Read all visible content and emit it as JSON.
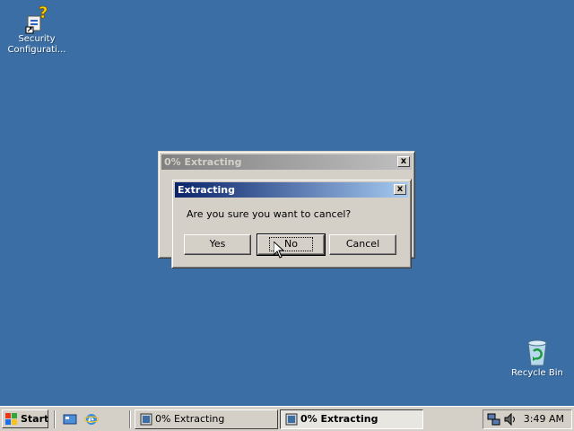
{
  "desktop": {
    "icons": [
      {
        "label": "Security Configurati...",
        "icon": "security-config-icon"
      },
      {
        "label": "Recycle Bin",
        "icon": "recycle-bin-icon"
      }
    ]
  },
  "background_window": {
    "title": "0% Extracting",
    "close_label": "x"
  },
  "dialog": {
    "title": "Extracting",
    "close_label": "x",
    "message": "Are you sure you want to cancel?",
    "buttons": {
      "yes": "Yes",
      "no": "No",
      "cancel": "Cancel"
    }
  },
  "taskbar": {
    "start_label": "Start",
    "quick_launch": [
      "show-desktop-icon",
      "internet-explorer-icon"
    ],
    "tasks": [
      {
        "label": "0% Extracting",
        "active": false
      },
      {
        "label": "0% Extracting",
        "active": true
      }
    ],
    "tray_icons": [
      "network-icon",
      "volume-icon"
    ],
    "clock": "3:49 AM"
  },
  "colors": {
    "desktop": "#3a6ea5",
    "active_title": "#0a246a",
    "inactive_title": "#808080",
    "face": "#d4d0c8"
  }
}
